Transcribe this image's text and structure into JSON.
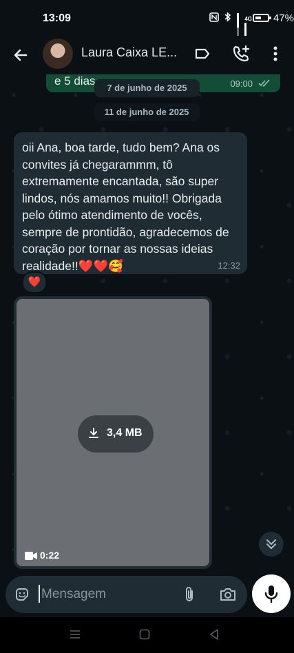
{
  "status_bar": {
    "time": "13:09",
    "network": "4G",
    "battery_percent": "47%",
    "battery_level": 0.47
  },
  "header": {
    "contact_name": "Laura Caixa LE...",
    "avatar_icon": "avatar-photo",
    "icons": [
      "back-arrow-icon",
      "label-icon",
      "add-call-icon",
      "more-vert-icon"
    ]
  },
  "chat": {
    "previous_message_fragment": "e 5 dias",
    "previous_message_time": "09:00",
    "date_sticky": "7 de junho de 2025",
    "date_separator": "11 de junho de 2025",
    "message": {
      "text": "oii Ana, boa tarde, tudo bem? Ana os convites já chegarammm, tô extremamente encantada, são super lindos, nós amamos muito!! Obrigada pelo ótimo atendimento de vocês, sempre de prontidão, agradecemos de coração por tornar as nossas ideias realidade!!❤️❤️🥰",
      "time": "12:32",
      "reaction": "❤️"
    },
    "media": {
      "size": "3,4 MB",
      "duration": "0:22",
      "type": "video"
    }
  },
  "input": {
    "placeholder": "Mensagem"
  },
  "colors": {
    "background": "#0b1014",
    "incoming_bubble": "#202c33",
    "outgoing_bubble": "#144d37",
    "accent": "#ffffff"
  }
}
